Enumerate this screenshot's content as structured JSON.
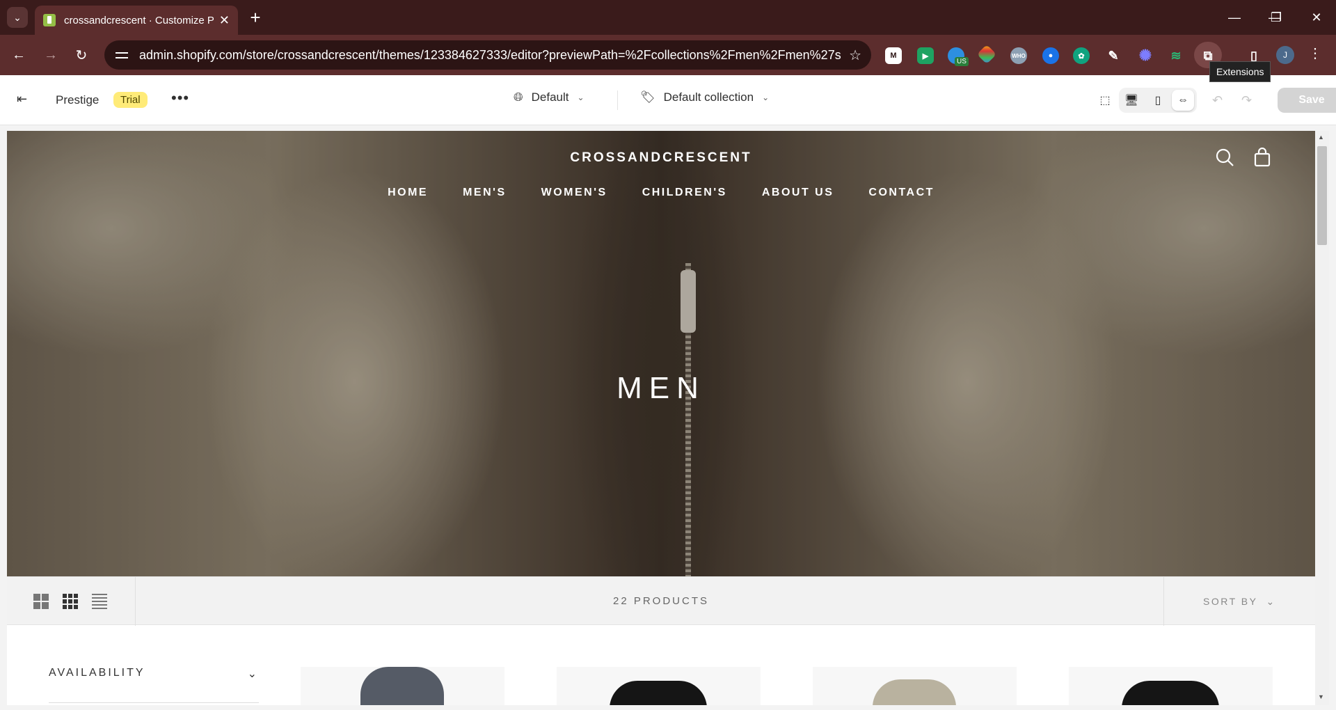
{
  "browser": {
    "tab_title": "crossandcrescent · Customize P",
    "url": "admin.shopify.com/store/crossandcrescent/themes/123384627333/editor?previewPath=%2Fcollections%2Fmen%2Fmen%27s",
    "tooltip": "Extensions",
    "profile_initial": "J",
    "ext_badge": "US"
  },
  "editor": {
    "theme_name": "Prestige",
    "trial_badge": "Trial",
    "more": "•••",
    "template_selector": "Default",
    "collection_selector": "Default collection",
    "save_label": "Save"
  },
  "store": {
    "logo": "CROSSANDCRESCENT",
    "nav": [
      "HOME",
      "MEN'S",
      "WOMEN'S",
      "CHILDREN'S",
      "ABOUT US",
      "CONTACT"
    ],
    "hero_title": "MEN",
    "product_count": "22 PRODUCTS",
    "sort_label": "SORT BY",
    "filter_availability": "AVAILABILITY"
  },
  "colors": {
    "chrome_tab_bg": "#3a1b1b",
    "chrome_toolbar_bg": "#5c2d2d",
    "trial_badge": "#ffeb78",
    "save_disabled": "#d4d4d4"
  },
  "icons": [
    "tab-list-icon",
    "shopify-favicon",
    "close-icon",
    "plus-icon",
    "minimize-icon",
    "restore-icon",
    "close-window-icon",
    "back-icon",
    "forward-icon",
    "reload-icon",
    "site-info-icon",
    "star-icon",
    "extensions-icon",
    "side-panel-icon",
    "kebab-menu-icon",
    "exit-icon",
    "globe-icon",
    "tag-icon",
    "inspector-icon",
    "desktop-icon",
    "mobile-icon",
    "fullscreen-icon",
    "undo-icon",
    "redo-icon",
    "search-icon",
    "bag-icon",
    "grid-2-icon",
    "grid-3-icon",
    "list-view-icon",
    "chevron-down-icon"
  ]
}
